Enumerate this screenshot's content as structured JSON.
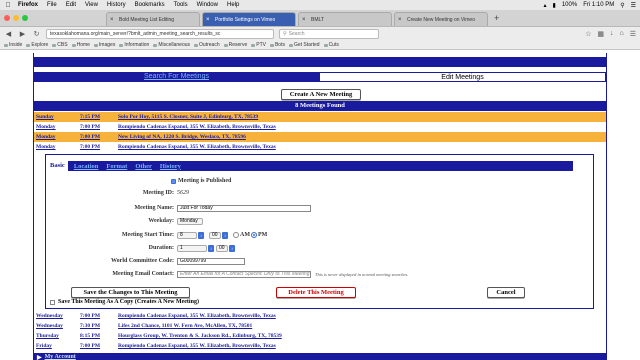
{
  "menubar": {
    "app": "Firefox",
    "items": [
      "File",
      "Edit",
      "View",
      "History",
      "Bookmarks",
      "Tools",
      "Window",
      "Help"
    ],
    "battery": "100%",
    "clock": "Fri 1:10 PM"
  },
  "browser": {
    "tabs": [
      {
        "label": "Bold Meeting List Editing",
        "active": false
      },
      {
        "label": "Portfolio Settings on Vimeo",
        "active": true
      },
      {
        "label": "BMLT",
        "active": false
      },
      {
        "label": "Create New Meeting on Vimeo",
        "active": false
      }
    ],
    "url": "texasoklahomana.org/main_server/?bmlt_admin_meeting_search_results_sc",
    "search_placeholder": "Search",
    "bookmarks": [
      "Inside",
      "Explore",
      "CBS",
      "Home",
      "Images",
      "Information",
      "Miscellaneous",
      "Outreach",
      "Reserve",
      "PTV",
      "Bots",
      "Get Started",
      "Cuts"
    ]
  },
  "page": {
    "tab_search": "Search For Meetings",
    "tab_edit": "Edit Meetings",
    "create_button": "Create A New Meeting",
    "found_text": "8 Meetings Found",
    "meetings_top": [
      {
        "day": "Sunday",
        "time": "7:15 PM",
        "location": "Solo Por Hoy, 5115 S. Closner, Suite J, Edinburg, TX, 78539",
        "highlight": true
      },
      {
        "day": "Monday",
        "time": "7:00 PM",
        "location": "Rompiendo Cadenas Espanol, 355 W. Elizabeth, Brownsville, Texas",
        "highlight": false
      },
      {
        "day": "Monday",
        "time": "7:00 PM",
        "location": "New Living of NA, 1220 S. Bridge, Weslaco, TX, 78596",
        "highlight": true
      },
      {
        "day": "Monday",
        "time": "7:00 PM",
        "location": "Rompiendo Cadenas Espanol, 355 W. Elizabeth, Brownsville, Texas",
        "highlight": false
      }
    ],
    "edit_tabs": [
      "Basic",
      "Location",
      "Format",
      "Other",
      "History"
    ],
    "form": {
      "published_label": "Meeting is Published",
      "meeting_id_label": "Meeting ID:",
      "meeting_id": "5629",
      "meeting_name_label": "Meeting Name:",
      "meeting_name": "Just For Today",
      "weekday_label": "Weekday:",
      "weekday": "Monday",
      "start_time_label": "Meeting Start Time:",
      "start_hour": "8",
      "start_min": "00",
      "am_label": "AM",
      "pm_label": "PM",
      "duration_label": "Duration:",
      "duration_hours": "1",
      "duration_min": "00",
      "wcc_label": "World Committee Code:",
      "wcc": "G00099799",
      "email_label": "Meeting Email Contact:",
      "email_placeholder": "Enter An Email for A Contact Specific Only to This Meeting",
      "email_note": "This is never displayed in normal meeting searches."
    },
    "save_button": "Save the Changes to This Meeting",
    "delete_button": "Delete This Meeting",
    "cancel_button": "Cancel",
    "copy_label": "Save This Meeting As A Copy (Creates A New Meeting)",
    "meetings_bottom": [
      {
        "day": "Wednesday",
        "time": "7:00 PM",
        "location": "Rompiendo Cadenas Espanol, 355 W. Elizabeth, Brownsville, Texas"
      },
      {
        "day": "Wednesday",
        "time": "7:30 PM",
        "location": "Lifes 2nd Chance, 1101 W. Fern Ave, McAllen, TX, 78501"
      },
      {
        "day": "Thursday",
        "time": "8:15 PM",
        "location": "Hourglass Group, W. Trenton & S. Jackson Rd., Edinburg, TX, 78539"
      },
      {
        "day": "Friday",
        "time": "7:00 PM",
        "location": "Rompiendo Cadenas Espanol, 355 W. Elizabeth, Brownsville, Texas"
      }
    ],
    "my_account": "My Account"
  },
  "colors": {
    "navy": "#1a1a9e",
    "highlight": "#f7b23b",
    "link_light": "#7ab4ff"
  }
}
